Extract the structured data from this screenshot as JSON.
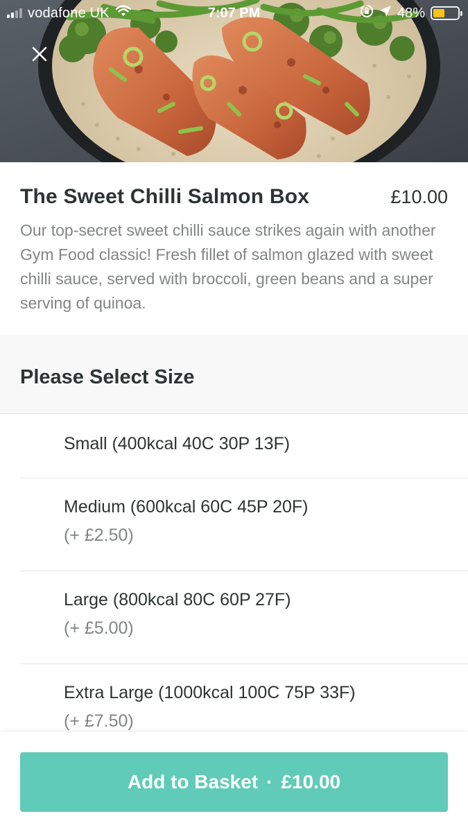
{
  "status_bar": {
    "carrier": "vodafone UK",
    "time": "7:07 PM",
    "battery": "48%",
    "battery_level": 0.48,
    "battery_color": "#f5c518"
  },
  "header": {
    "close_icon": "close-icon",
    "hero_image": "salmon-box-photo"
  },
  "product": {
    "title": "The Sweet Chilli Salmon Box",
    "price": "£10.00",
    "description": "Our top-secret sweet chilli sauce strikes again with another Gym Food classic! Fresh fillet of salmon glazed with sweet chilli sauce, served with broccoli, green beans and a super serving of quinoa."
  },
  "size_section": {
    "title": "Please Select Size",
    "options": [
      {
        "name": "Small (400kcal 40C 30P 13F)",
        "extra": ""
      },
      {
        "name": "Medium (600kcal 60C 45P 20F)",
        "extra": "(+ £2.50)"
      },
      {
        "name": "Large (800kcal 80C 60P 27F)",
        "extra": "(+ £5.00)"
      },
      {
        "name": "Extra Large (1000kcal 100C 75P 33F)",
        "extra": "(+ £7.50)"
      }
    ]
  },
  "basket": {
    "label": "Add to Basket",
    "separator": "·",
    "price": "£10.00",
    "color": "#5fcbb8"
  }
}
